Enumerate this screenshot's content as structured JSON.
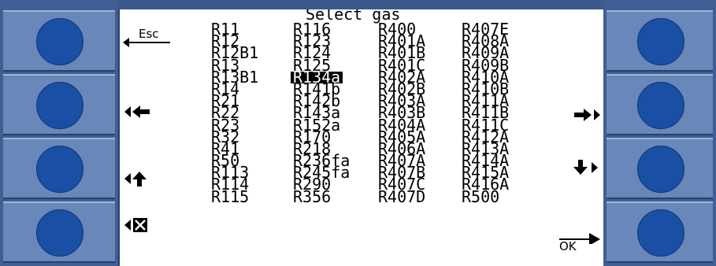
{
  "title": "Select gas",
  "softkeys_left": {
    "esc": "Esc"
  },
  "softkeys_right": {
    "ok": "OK"
  },
  "selected": "R134a",
  "columns": [
    [
      "R11",
      "R12",
      "R12B1",
      "R13",
      "R13B1",
      "R14",
      "R21",
      "R22",
      "R23",
      "R32",
      "R41",
      "R50",
      "R113",
      "R114",
      "R115"
    ],
    [
      "R116",
      "R123",
      "R124",
      "R125",
      "R134a",
      "R141b",
      "R142b",
      "R143a",
      "R152a",
      "R170",
      "R218",
      "R236fa",
      "R245fa",
      "R290",
      "R356"
    ],
    [
      "R400",
      "R401A",
      "R401B",
      "R401C",
      "R402A",
      "R402B",
      "R403A",
      "R403B",
      "R404A",
      "R405A",
      "R406A",
      "R407A",
      "R407B",
      "R407C",
      "R407D"
    ],
    [
      "R407E",
      "R408A",
      "R409A",
      "R409B",
      "R410A",
      "R410B",
      "R411A",
      "R411B",
      "R411C",
      "R412A",
      "R413A",
      "R414A",
      "R415A",
      "R416A",
      "R500"
    ]
  ],
  "colors": {
    "frame": "#3b5a8c",
    "button": "#6987b8",
    "knob": "#1a4fa6",
    "screen": "#ffffff",
    "highlight": "#000000"
  },
  "icons": [
    "back-arrow-icon",
    "page-left-icon",
    "page-up-icon",
    "delete-icon",
    "page-right-icon",
    "page-down-icon",
    "enter-arrow-icon"
  ]
}
